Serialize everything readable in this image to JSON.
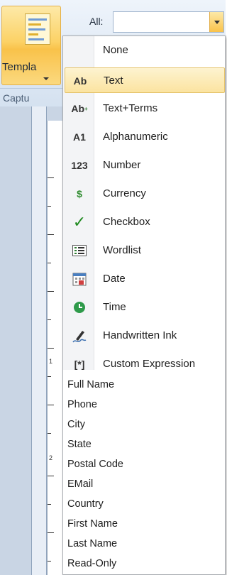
{
  "ribbon": {
    "template_label": "Templa",
    "group_label": "Captu",
    "all_label": "All:",
    "all_value": ""
  },
  "menu": {
    "typed_items": [
      {
        "label": "None",
        "icon": "",
        "icon_name": "none"
      },
      {
        "label": "Text",
        "icon": "Ab",
        "icon_name": "text-icon",
        "highlighted": true
      },
      {
        "label": "Text+Terms",
        "icon": "Ab",
        "icon_name": "text-terms-icon"
      },
      {
        "label": "Alphanumeric",
        "icon": "A1",
        "icon_name": "alphanumeric-icon"
      },
      {
        "label": "Number",
        "icon": "123",
        "icon_name": "number-icon"
      },
      {
        "label": "Currency",
        "icon": "$",
        "icon_name": "currency-icon"
      },
      {
        "label": "Checkbox",
        "icon": "✓",
        "icon_name": "checkbox-icon"
      },
      {
        "label": "Wordlist",
        "icon": "",
        "icon_name": "wordlist-icon"
      },
      {
        "label": "Date",
        "icon": "",
        "icon_name": "date-icon"
      },
      {
        "label": "Time",
        "icon": "",
        "icon_name": "time-icon"
      },
      {
        "label": "Handwritten Ink",
        "icon": "",
        "icon_name": "handwritten-ink-icon"
      },
      {
        "label": "Custom Expression",
        "icon": "[*]",
        "icon_name": "custom-expression-icon"
      }
    ],
    "simple_items": [
      "Full Name",
      "Phone",
      "City",
      "State",
      "Postal Code",
      "EMail",
      "Country",
      "First Name",
      "Last Name",
      "Read-Only"
    ]
  },
  "ruler": {
    "numbers": [
      "1",
      "2"
    ]
  },
  "colors": {
    "highlight": "#fbe3a0",
    "accent": "#f9c24a",
    "currency": "#2e8b2e",
    "checkbox": "#1f8a1f",
    "time": "#2e9a4a",
    "date": "#d04040"
  }
}
